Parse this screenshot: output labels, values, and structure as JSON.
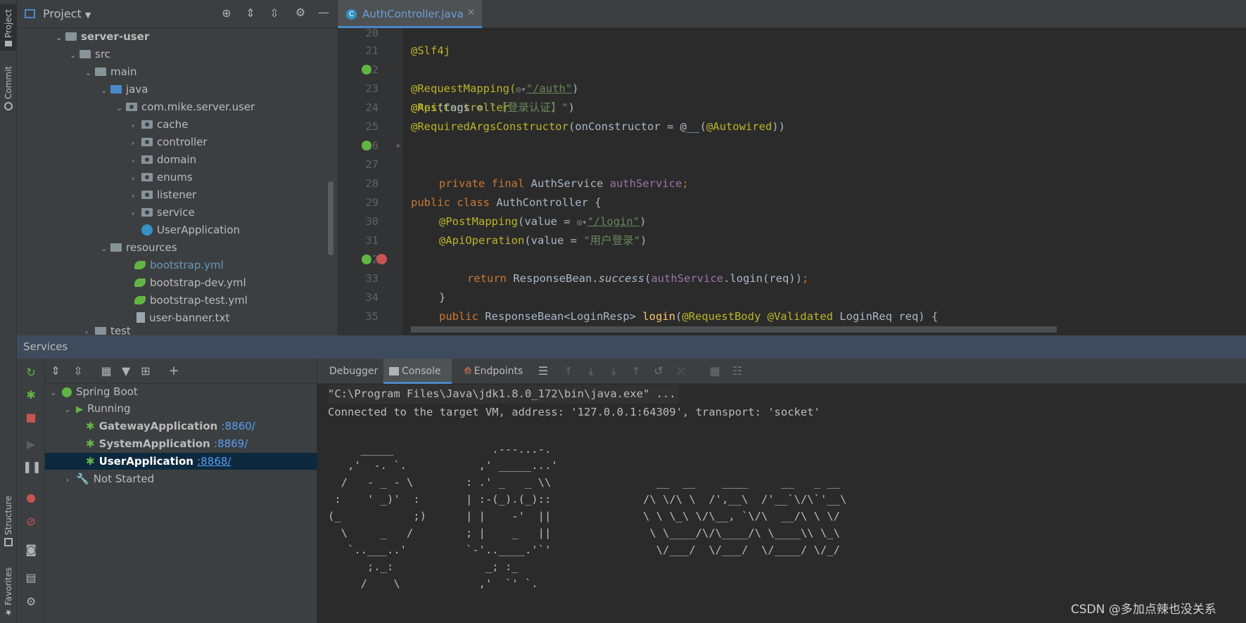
{
  "left_strip": {
    "project": "Project",
    "commit": "Commit",
    "structure": "Structure",
    "favorites": "Favorites"
  },
  "project_panel": {
    "title": "Project",
    "tree": [
      {
        "label": "server-user",
        "bold": true
      },
      {
        "label": "src"
      },
      {
        "label": "main"
      },
      {
        "label": "java"
      },
      {
        "label": "com.mike.server.user"
      },
      {
        "label": "cache"
      },
      {
        "label": "controller"
      },
      {
        "label": "domain"
      },
      {
        "label": "enums"
      },
      {
        "label": "listener"
      },
      {
        "label": "service"
      },
      {
        "label": "UserApplication"
      },
      {
        "label": "resources"
      },
      {
        "label": "bootstrap.yml"
      },
      {
        "label": "bootstrap-dev.yml"
      },
      {
        "label": "bootstrap-test.yml"
      },
      {
        "label": "user-banner.txt"
      },
      {
        "label": "test"
      }
    ]
  },
  "editor": {
    "tab_label": "AuthController.java",
    "tab_icon": "C",
    "line_numbers": [
      "20",
      "21",
      "22",
      "23",
      "24",
      "25",
      "26",
      "27",
      "28",
      "29",
      "30",
      "31",
      "32",
      "33",
      "34",
      "35"
    ],
    "code": {
      "l21": "@Slf4j",
      "l22": "@RestController",
      "l23_a": "@RequestMapping(",
      "l23_url": "\"/auth\"",
      "l23_b": ")",
      "l24_a": "@Api",
      "l24_b": "(tags = ",
      "l24_str": "\"【登录认证】\"",
      "l24_c": ")",
      "l25_a": "@RequiredArgsConstructor",
      "l25_b": "(onConstructor = @__(",
      "l25_c": "@Autowired",
      "l25_d": "))",
      "l26_kw": "public class ",
      "l26_rest": "AuthController {",
      "l28_kw": "private final ",
      "l28_type": "AuthService ",
      "l28_fld": "authService",
      "l28_end": ";",
      "l30_a": "@PostMapping",
      "l30_b": "(value = ",
      "l30_url": "\"/login\"",
      "l30_c": ")",
      "l31_a": "@ApiOperation",
      "l31_b": "(value = ",
      "l31_str": "\"用户登录\"",
      "l31_c": ")",
      "l32_kw": "public ",
      "l32_type": "ResponseBean<LoginResp> ",
      "l32_fn": "login",
      "l32_p1": "(",
      "l32_ann1": "@RequestBody ",
      "l32_ann2": "@Validated ",
      "l32_rest": "LoginReq req) {",
      "l33_kw": "return ",
      "l33_a": "ResponseBean.",
      "l33_it": "success",
      "l33_b": "(",
      "l33_fld": "authService",
      "l33_c": ".login(req))",
      "l33_end": ";",
      "l34": "}"
    }
  },
  "services": {
    "title": "Services",
    "tree": {
      "spring_boot": "Spring Boot",
      "running": "Running",
      "apps": [
        {
          "name": "GatewayApplication",
          "port": ":8860/"
        },
        {
          "name": "SystemApplication",
          "port": ":8869/"
        },
        {
          "name": "UserApplication",
          "port": ":8868/"
        }
      ],
      "not_started": "Not Started"
    }
  },
  "console": {
    "tabs": {
      "debugger": "Debugger",
      "console": "Console",
      "endpoints": "Endpoints"
    },
    "lines": [
      "\"C:\\Program Files\\Java\\jdk1.8.0_172\\bin\\java.exe\" ...",
      "Connected to the target VM, address: '127.0.0.1:64309', transport: 'socket'"
    ],
    "banner": [
      "     _____               .---...-.",
      "   ,'  -. `.           ,' _____...'",
      "  /   - _ - \\        : .' _   _ \\\\",
      " :    ' _)'  :       | :-(_).(_)::",
      "(_           ;)      | |    -'  ||",
      "  \\     _   /        ; |    _   ||",
      "   `..___..'         `-'..____.'`'",
      "      ;._:              _; :_",
      "     /    \\            ,'  `' `."
    ],
    "logo": [
      "  __  __    ____     __   _ __",
      "/\\ \\/\\ \\  /',__\\  /'__`\\/\\`'__\\",
      "\\ \\ \\_\\ \\/\\__, `\\/\\  __/\\ \\ \\/",
      " \\ \\____/\\/\\____/\\ \\____\\\\ \\_\\",
      "  \\/___/  \\/___/  \\/____/ \\/_/"
    ]
  },
  "watermark": "CSDN @多加点辣也没关系",
  "colors": {
    "accent": "#4a88c7",
    "selection": "#0d293e",
    "header": "#3d4b5c"
  }
}
